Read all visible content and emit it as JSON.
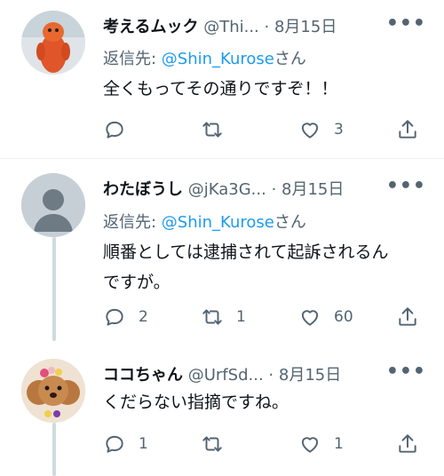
{
  "tweets": [
    {
      "name": "考えるムック",
      "handle": "@Thi...",
      "dot": "·",
      "date": "8月15日",
      "more": "•••",
      "reply_prefix": "返信先: ",
      "reply_mention": "@Shin_Kurose",
      "reply_suffix": "さん",
      "body": "全くもってその通りですぞ！！",
      "counts": {
        "reply": "",
        "retweet": "",
        "like": "3"
      },
      "avatar": "orange-mascot"
    },
    {
      "name": "わたぼうし",
      "handle": "@jKa3G...",
      "dot": "·",
      "date": "8月15日",
      "more": "•••",
      "reply_prefix": "返信先: ",
      "reply_mention": "@Shin_Kurose",
      "reply_suffix": "さん",
      "body": "順番としては逮捕されて起訴されるんですが。",
      "counts": {
        "reply": "2",
        "retweet": "1",
        "like": "60"
      },
      "avatar": "default-profile"
    },
    {
      "name": "ココちゃん",
      "handle": "@UrfSd...",
      "dot": "·",
      "date": "8月15日",
      "more": "•••",
      "body": "くだらない指摘ですね。",
      "counts": {
        "reply": "1",
        "retweet": "",
        "like": "1"
      },
      "avatar": "poodle-dog"
    }
  ],
  "icons": {
    "reply": "reply-bubble-icon",
    "retweet": "retweet-icon",
    "like": "heart-icon",
    "share": "share-upload-icon",
    "more": "more-dots-icon"
  },
  "colors": {
    "accent": "#1d9bf0",
    "muted": "#536471",
    "text": "#0f1419",
    "thread": "#cfd9de"
  }
}
